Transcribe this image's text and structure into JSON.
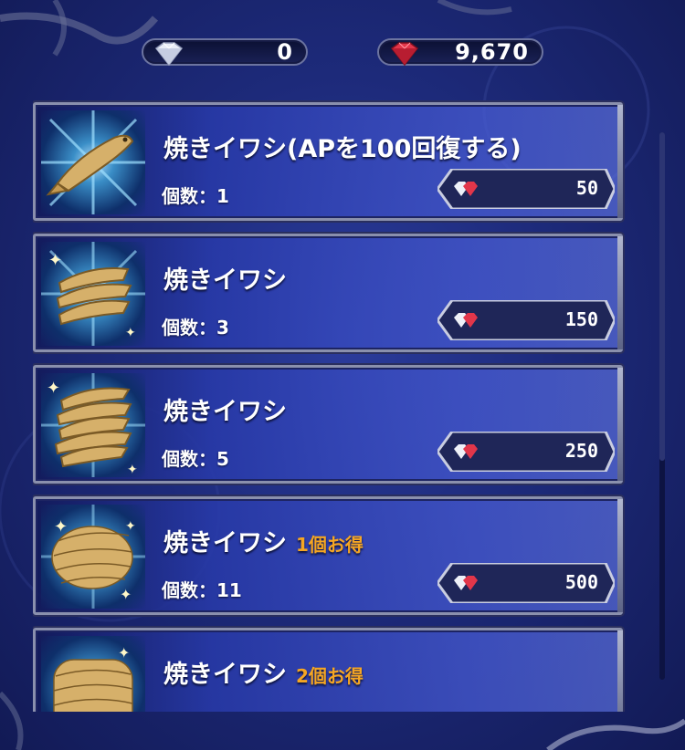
{
  "currencies": {
    "silver": {
      "value": "0",
      "icon": "white-gem-icon"
    },
    "red": {
      "value": "9,670",
      "icon": "red-gem-icon"
    }
  },
  "shop": {
    "items": [
      {
        "title": "焼きイワシ(APを100回復する)",
        "note": "",
        "qty": "個数：1",
        "price": "50",
        "icon": "sardine-1-icon"
      },
      {
        "title": "焼きイワシ",
        "note": "",
        "qty": "個数：3",
        "price": "150",
        "icon": "sardine-3-icon"
      },
      {
        "title": "焼きイワシ",
        "note": "",
        "qty": "個数：5",
        "price": "250",
        "icon": "sardine-5-icon"
      },
      {
        "title": "焼きイワシ",
        "note": "1個お得",
        "qty": "個数：11",
        "price": "500",
        "icon": "sardine-11-icon"
      },
      {
        "title": "焼きイワシ",
        "note": "2個お得",
        "qty": "",
        "price": "",
        "icon": "sardine-pile-icon"
      }
    ]
  },
  "colors": {
    "accent": "#f5a623",
    "panel": "#2b3c9c"
  }
}
